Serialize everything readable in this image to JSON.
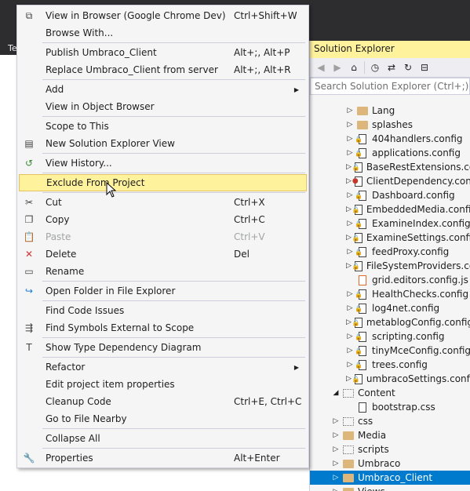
{
  "background": {
    "tab_label": "Te"
  },
  "solution_explorer": {
    "title": "Solution Explorer",
    "search_placeholder": "Search Solution Explorer (Ctrl+;)",
    "items": [
      {
        "label": "Lang",
        "type": "folder",
        "indent": 2,
        "expander": "right"
      },
      {
        "label": "splashes",
        "type": "folder",
        "indent": 2,
        "expander": "right"
      },
      {
        "label": "404handlers.config",
        "type": "config",
        "indent": 2,
        "expander": "right"
      },
      {
        "label": "applications.config",
        "type": "config",
        "indent": 2,
        "expander": "right"
      },
      {
        "label": "BaseRestExtensions.config",
        "type": "config",
        "indent": 2,
        "expander": "right"
      },
      {
        "label": "ClientDependency.config",
        "type": "config-minus",
        "indent": 2,
        "expander": "right"
      },
      {
        "label": "Dashboard.config",
        "type": "config",
        "indent": 2,
        "expander": "right"
      },
      {
        "label": "EmbeddedMedia.config",
        "type": "config",
        "indent": 2,
        "expander": "right"
      },
      {
        "label": "ExamineIndex.config",
        "type": "config",
        "indent": 2,
        "expander": "right"
      },
      {
        "label": "ExamineSettings.config",
        "type": "config",
        "indent": 2,
        "expander": "right"
      },
      {
        "label": "feedProxy.config",
        "type": "config",
        "indent": 2,
        "expander": "right"
      },
      {
        "label": "FileSystemProviders.config",
        "type": "config",
        "indent": 2,
        "expander": "right"
      },
      {
        "label": "grid.editors.config.js",
        "type": "js",
        "indent": 2,
        "expander": ""
      },
      {
        "label": "HealthChecks.config",
        "type": "config",
        "indent": 2,
        "expander": "right"
      },
      {
        "label": "log4net.config",
        "type": "config",
        "indent": 2,
        "expander": "right"
      },
      {
        "label": "metablogConfig.config",
        "type": "config",
        "indent": 2,
        "expander": "right"
      },
      {
        "label": "scripting.config",
        "type": "config",
        "indent": 2,
        "expander": "right"
      },
      {
        "label": "tinyMceConfig.config",
        "type": "config",
        "indent": 2,
        "expander": "right"
      },
      {
        "label": "trees.config",
        "type": "config",
        "indent": 2,
        "expander": "right"
      },
      {
        "label": "umbracoSettings.config",
        "type": "config",
        "indent": 2,
        "expander": "right"
      },
      {
        "label": "Content",
        "type": "folder-open",
        "indent": 1,
        "expander": "down"
      },
      {
        "label": "bootstrap.css",
        "type": "file",
        "indent": 2,
        "expander": ""
      },
      {
        "label": "css",
        "type": "folder-open",
        "indent": 1,
        "expander": "right"
      },
      {
        "label": "Media",
        "type": "folder",
        "indent": 1,
        "expander": "right"
      },
      {
        "label": "scripts",
        "type": "folder-open",
        "indent": 1,
        "expander": "right"
      },
      {
        "label": "Umbraco",
        "type": "folder",
        "indent": 1,
        "expander": "right"
      },
      {
        "label": "Umbraco_Client",
        "type": "folder",
        "indent": 1,
        "expander": "right",
        "selected": true
      },
      {
        "label": "Views",
        "type": "folder",
        "indent": 1,
        "expander": "right"
      }
    ]
  },
  "context_menu": {
    "items": [
      {
        "label": "View in Browser (Google Chrome Dev)",
        "shortcut": "Ctrl+Shift+W",
        "icon": "browser-icon",
        "glyph": "⧉"
      },
      {
        "label": "Browse With...",
        "shortcut": "",
        "icon": "",
        "glyph": ""
      },
      {
        "sep": true
      },
      {
        "label": "Publish Umbraco_Client",
        "shortcut": "Alt+;, Alt+P",
        "icon": "",
        "glyph": ""
      },
      {
        "label": "Replace Umbraco_Client from server",
        "shortcut": "Alt+;, Alt+R",
        "icon": "",
        "glyph": ""
      },
      {
        "sep": true
      },
      {
        "label": "Add",
        "shortcut": "",
        "icon": "",
        "glyph": "",
        "submenu": true
      },
      {
        "label": "View in Object Browser",
        "shortcut": "",
        "icon": "",
        "glyph": ""
      },
      {
        "sep": true
      },
      {
        "label": "Scope to This",
        "shortcut": "",
        "icon": "",
        "glyph": ""
      },
      {
        "label": "New Solution Explorer View",
        "shortcut": "",
        "icon": "solution-explorer-view-icon",
        "glyph": "▤"
      },
      {
        "sep": true
      },
      {
        "label": "View History...",
        "shortcut": "",
        "icon": "history-icon",
        "glyph": "↺"
      },
      {
        "sep": true
      },
      {
        "label": "Exclude From Project",
        "shortcut": "",
        "icon": "",
        "glyph": "",
        "highlighted": true
      },
      {
        "sep": true
      },
      {
        "label": "Cut",
        "shortcut": "Ctrl+X",
        "icon": "scissors-icon",
        "glyph": "✂"
      },
      {
        "label": "Copy",
        "shortcut": "Ctrl+C",
        "icon": "copy-icon",
        "glyph": "❐"
      },
      {
        "label": "Paste",
        "shortcut": "Ctrl+V",
        "icon": "paste-icon",
        "glyph": "📋",
        "disabled": true
      },
      {
        "label": "Delete",
        "shortcut": "Del",
        "icon": "delete-icon",
        "glyph": "✕"
      },
      {
        "label": "Rename",
        "shortcut": "",
        "icon": "rename-icon",
        "glyph": "▭"
      },
      {
        "sep": true
      },
      {
        "label": "Open Folder in File Explorer",
        "shortcut": "",
        "icon": "open-folder-icon",
        "glyph": "↪"
      },
      {
        "sep": true
      },
      {
        "label": "Find Code Issues",
        "shortcut": "",
        "icon": "",
        "glyph": ""
      },
      {
        "label": "Find Symbols External to Scope",
        "shortcut": "",
        "icon": "find-symbols-icon",
        "glyph": "⇶"
      },
      {
        "sep": true
      },
      {
        "label": "Show Type Dependency Diagram",
        "shortcut": "",
        "icon": "dependency-diagram-icon",
        "glyph": "T"
      },
      {
        "sep": true
      },
      {
        "label": "Refactor",
        "shortcut": "",
        "icon": "",
        "glyph": "",
        "submenu": true
      },
      {
        "label": "Edit project item properties",
        "shortcut": "",
        "icon": "",
        "glyph": ""
      },
      {
        "label": "Cleanup Code",
        "shortcut": "Ctrl+E, Ctrl+C",
        "icon": "",
        "glyph": ""
      },
      {
        "label": "Go to File Nearby",
        "shortcut": "",
        "icon": "",
        "glyph": ""
      },
      {
        "sep": true
      },
      {
        "label": "Collapse All",
        "shortcut": "",
        "icon": "",
        "glyph": ""
      },
      {
        "sep": true
      },
      {
        "label": "Properties",
        "shortcut": "Alt+Enter",
        "icon": "wrench-icon",
        "glyph": "🔧"
      }
    ]
  }
}
